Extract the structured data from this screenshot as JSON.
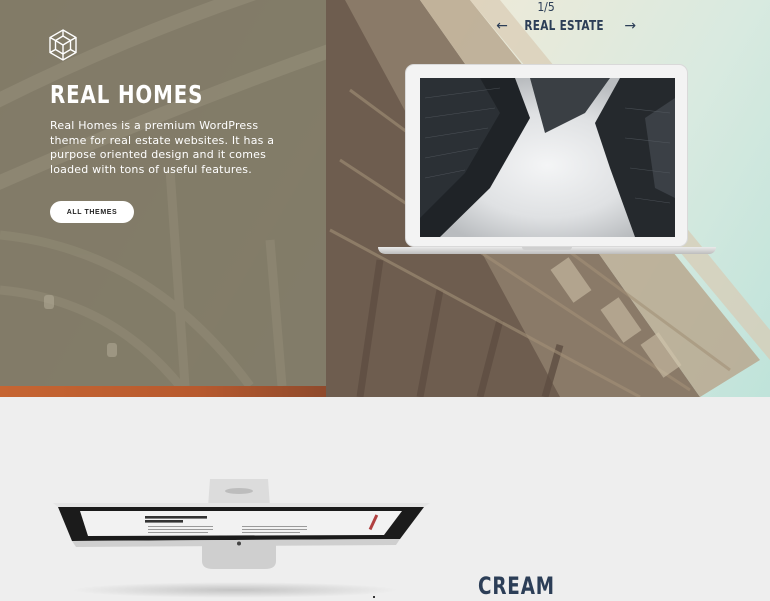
{
  "hero": {
    "title": "REAL HOMES",
    "description": "Real Homes is a premium WordPress theme for real estate websites. It has a purpose oriented design and it comes loaded with tons of useful features.",
    "button_label": "ALL THEMES",
    "logo_icon": "hexagon-cube-icon"
  },
  "slider": {
    "counter": "1/5",
    "category": "REAL ESTATE",
    "prev_icon": "arrow-left-icon",
    "next_icon": "arrow-right-icon"
  },
  "next_theme": {
    "title": "CREAM"
  },
  "colors": {
    "panel": "#7a7360",
    "navy": "#2c3e57",
    "accent_orange": "#c66532",
    "section_bg": "#eeeeee"
  }
}
